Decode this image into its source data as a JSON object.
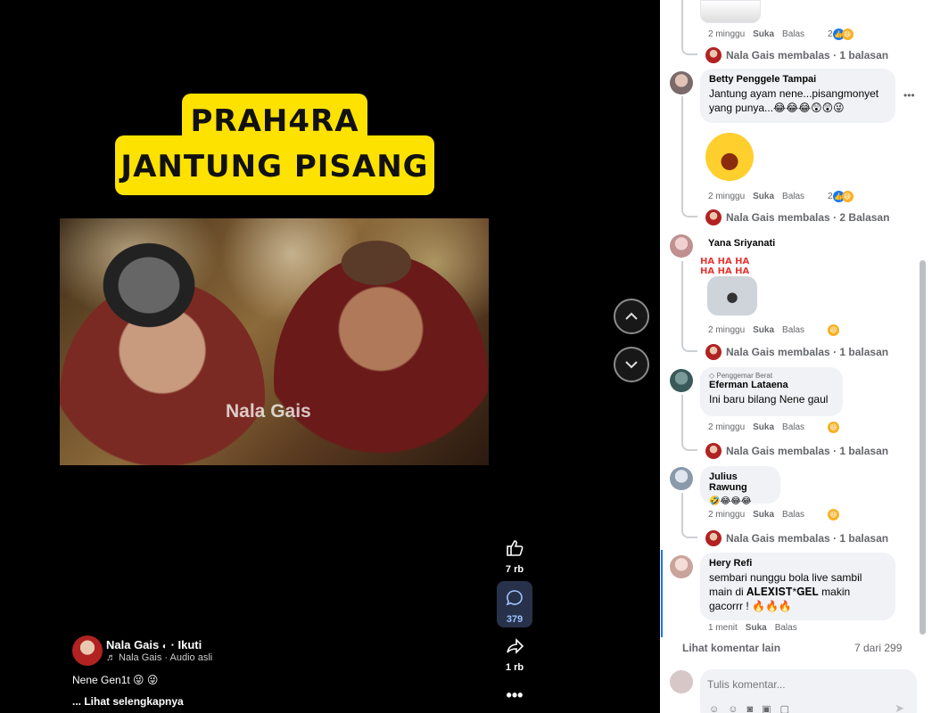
{
  "video": {
    "title_line1": "PRAH4RA",
    "title_line2": "JANTUNG PISANG",
    "watermark": "Nala Gais",
    "emoji_row": "😂😂😂",
    "likes": "7 rb",
    "comments": "379",
    "shares": "1 rb",
    "author": "Nala Gais",
    "follow_label": "· Ikuti",
    "audio": "♬ Nala Gais · Audio asli",
    "caption": "Nene Gen1t 😜 😜",
    "see_more": "... Lihat selengkapnya"
  },
  "comments": {
    "like_label": "Suka",
    "reply_label": "Balas",
    "items": [
      {
        "time": "2 minggu",
        "react_count": "2",
        "reply_line": "Nala Gais membalas · 1 balasan"
      },
      {
        "name": "Betty Penggele Tampai",
        "text": "Jantung ayam nene...pisangmonyet yang punya...😂😂😂😲😲😜",
        "time": "2 minggu",
        "react_count": "2",
        "reply_line": "Nala Gais membalas · 2 Balasan"
      },
      {
        "name": "Yana Sriyanati",
        "time": "2 minggu",
        "reply_line": "Nala Gais membalas · 1 balasan"
      },
      {
        "badge": "Penggemar Berat",
        "name": "Eferman Lataena",
        "text": "Ini baru bilang Nene gaul",
        "time": "2 minggu",
        "reply_line": "Nala Gais membalas · 1 balasan"
      },
      {
        "name": "Julius Rawung",
        "text": "🤣😂😂😂",
        "time": "2 minggu",
        "reply_line": "Nala Gais membalas · 1 balasan"
      },
      {
        "name": "Hery Refi",
        "text": "sembari nunggu bola live sambil main di 𝐀𝐋𝐄𝐗𝐈𝐒𝐓*𝐆𝐄𝐋 makin gacorrr ! 🔥🔥🔥",
        "time": "1 menit"
      }
    ],
    "view_more": "Lihat komentar lain",
    "count": "7 dari 299",
    "composer_placeholder": "Tulis komentar..."
  },
  "colors": {
    "title_yellow": "#fde200",
    "comment_accent": "#7ab0ff",
    "bubble_bg": "#f0f2f5"
  }
}
